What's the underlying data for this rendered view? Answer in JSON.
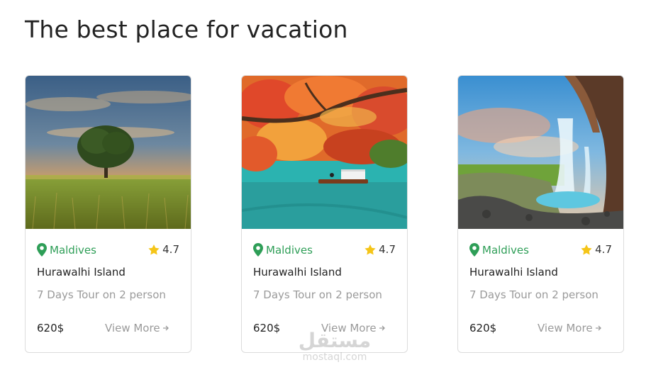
{
  "page": {
    "title": "The best place for vacation"
  },
  "cards": [
    {
      "image": "tree-field-sunset",
      "location": "Maldives",
      "rating": "4.7",
      "name": "Hurawalhi Island",
      "description": "7 Days Tour on 2 person",
      "price": "620$",
      "cta": "View More"
    },
    {
      "image": "autumn-river-boat",
      "location": "Maldives",
      "rating": "4.7",
      "name": "Hurawalhi Island",
      "description": "7 Days Tour on 2 person",
      "price": "620$",
      "cta": "View More"
    },
    {
      "image": "waterfall-cave",
      "location": "Maldives",
      "rating": "4.7",
      "name": "Hurawalhi Island",
      "description": "7 Days Tour on 2 person",
      "price": "620$",
      "cta": "View More"
    }
  ],
  "watermark": {
    "logo": "مستقل",
    "site": "mostaql.com"
  },
  "colors": {
    "location": "#2e9e57",
    "star": "#f5c518",
    "muted": "#9a9a9a"
  }
}
